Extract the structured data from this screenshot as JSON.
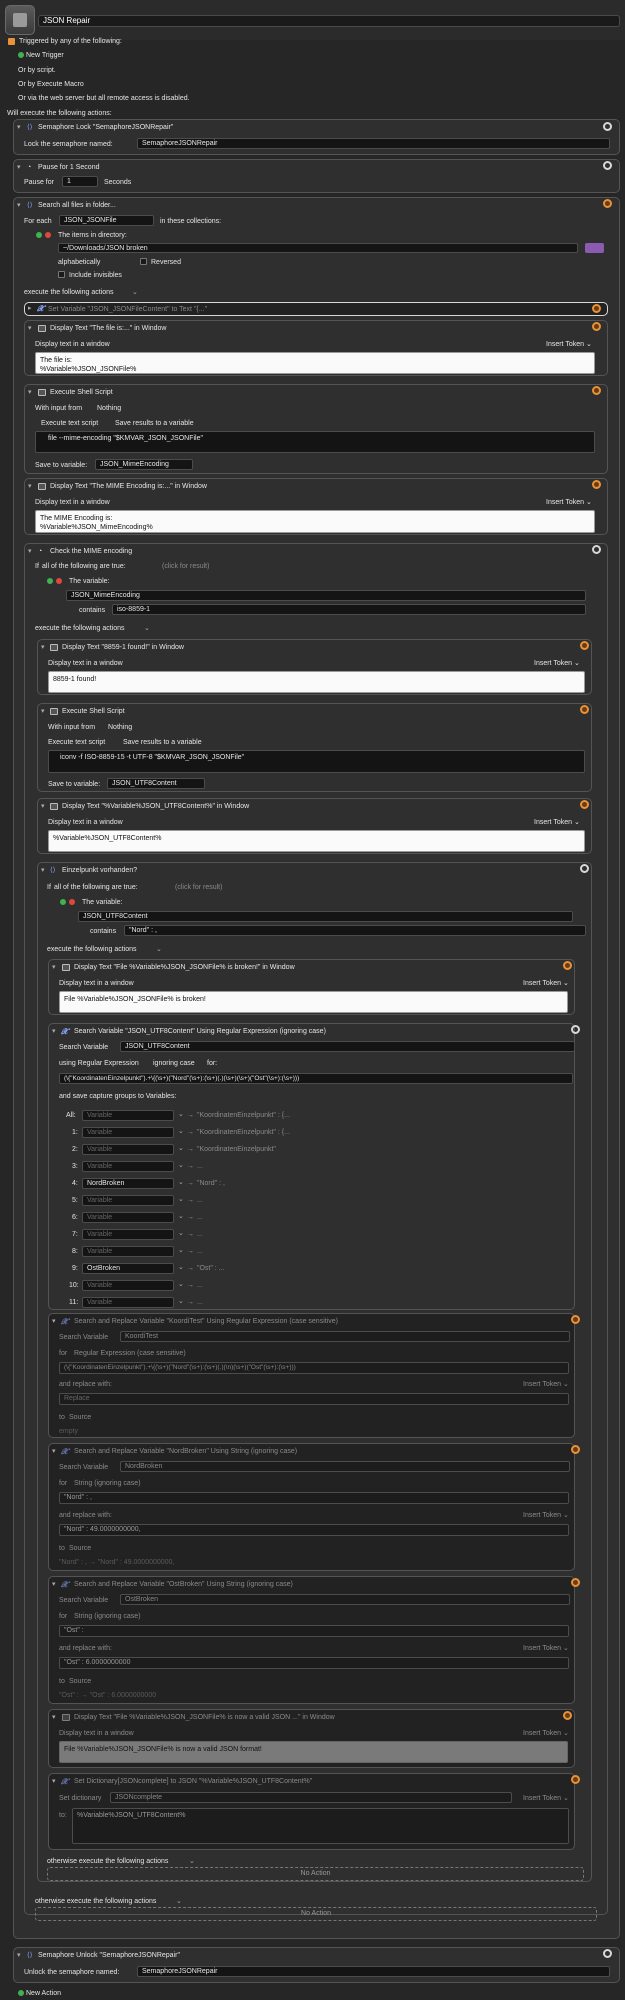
{
  "macro": {
    "name": "JSON Repair",
    "trigger_label": "Triggered by any of the following:",
    "new_trigger": "New Trigger",
    "or_by_script": "Or by script.",
    "or_by_execute_macro": "Or by Execute Macro",
    "web_server": "Or via the web server but all remote access is disabled.",
    "will_execute": "Will execute the following actions:",
    "new_action": "New Action"
  },
  "common": {
    "display_text_in_window": "Display text in a window",
    "insert_token": "Insert Token ⌄",
    "execute_following": "execute the following actions",
    "otherwise": "otherwise execute the following actions",
    "no_action": "No Action",
    "with_input_from": "With input from",
    "nothing": "Nothing",
    "execute_text_script": "Execute text script",
    "save_results": "Save results to a variable",
    "save_to_variable": "Save to variable:",
    "if": "If",
    "all_following_true": "all of the following are true:",
    "click_for_result": "(click for result)",
    "the_variable": "The variable:",
    "contains": "contains",
    "search": "Search",
    "variable": "Variable",
    "for": "for",
    "and_replace_with": "and replace with:",
    "to": "to",
    "source": "Source",
    "empty": "empty"
  },
  "semaphore_lock": {
    "title": "Semaphore Lock \"SemaphoreJSONRepair\"",
    "label": "Lock the semaphore named:",
    "value": "SemaphoreJSONRepair"
  },
  "pause": {
    "title": "Pause for 1 Second",
    "label": "Pause for",
    "value": "1",
    "unit": "Seconds"
  },
  "search_files": {
    "title": "Search all files in folder...",
    "for_each": "For each",
    "var": "JSON_JSONFile",
    "in_collections": "in these collections:",
    "items_in_dir": "The items in directory:",
    "dir": "~/Downloads/JSON broken",
    "sort": "alphabetically",
    "reversed": "Reversed",
    "include_invisibles": "Include invisibles"
  },
  "set_variable": {
    "title": "Set Variable \"JSON_JSONFileContent\" to Text \"{...\""
  },
  "display1": {
    "title": "Display Text \"The file is:...\" in Window",
    "text": "The file is:\n%Variable%JSON_JSONFile%"
  },
  "shell1": {
    "title": "Execute Shell Script",
    "script": "file --mime-encoding \"$KMVAR_JSON_JSONFile\"",
    "save_var": "JSON_MimeEncoding"
  },
  "display2": {
    "title": "Display Text \"The MIME Encoding is:...\" in Window",
    "text": "The MIME Encoding is:\n%Variable%JSON_MimeEncoding%"
  },
  "check_mime": {
    "title": "Check the MIME encoding",
    "variable": "JSON_MimeEncoding",
    "contains_value": "iso-8859-1"
  },
  "display3": {
    "title": "Display Text \"8859-1 found!\" in Window",
    "text": "8859-1 found!"
  },
  "shell2": {
    "title": "Execute Shell Script",
    "script": "iconv -f ISO-8859-15 -t  UTF-8 \"$KMVAR_JSON_JSONFile\"",
    "save_var": "JSON_UTF8Content"
  },
  "display4": {
    "title": "Display Text \"%Variable%JSON_UTF8Content%\" in Window",
    "text": "%Variable%JSON_UTF8Content%"
  },
  "einzel": {
    "title": "Einzelpunkt vorhanden?",
    "variable": "JSON_UTF8Content",
    "contains_value": "\"Nord\" : ,"
  },
  "display5": {
    "title": "Display Text \"File %Variable%JSON_JSONFile% is broken!\" in Window",
    "text": "File %Variable%JSON_JSONFile% is broken!"
  },
  "regex_search": {
    "title": "Search Variable \"JSON_UTF8Content\" Using Regular Expression (ignoring case)",
    "variable": "JSON_UTF8Content",
    "using": "using Regular Expression",
    "ignoring_case": "ignoring case",
    "for_label": "for:",
    "pattern": "(\\{\"KoordinatenEinzelpunkt\").+\\{(\\s+)(\"Nord\"(\\s+):(\\s+)(.)(\\s+)(\\s+)(\"Ost\"(\\s+):(\\s+)))",
    "save_label": "and save capture groups to Variables:",
    "placeholder": "Variable",
    "groups": [
      {
        "label": "All:",
        "var": "",
        "result": "\"KoordinatenEinzelpunkt\" : {..."
      },
      {
        "label": "1:",
        "var": "",
        "result": "\"KoordinatenEinzelpunkt\" : {..."
      },
      {
        "label": "2:",
        "var": "",
        "result": "\"KoordinatenEinzelpunkt\""
      },
      {
        "label": "3:",
        "var": "",
        "result": "..."
      },
      {
        "label": "4:",
        "var": "NordBroken",
        "result": "\"Nord\" : ,"
      },
      {
        "label": "5:",
        "var": "",
        "result": "..."
      },
      {
        "label": "6:",
        "var": "",
        "result": "..."
      },
      {
        "label": "7:",
        "var": "",
        "result": "..."
      },
      {
        "label": "8:",
        "var": "",
        "result": "..."
      },
      {
        "label": "9:",
        "var": "OstBroken",
        "result": "\"Ost\" : ..."
      },
      {
        "label": "10:",
        "var": "",
        "result": "..."
      },
      {
        "label": "11:",
        "var": "",
        "result": "..."
      }
    ]
  },
  "sr1": {
    "title": "Search and Replace Variable \"KoordiTest\" Using Regular Expression (case sensitive)",
    "variable": "KoordiTest",
    "mode": "Regular Expression (case sensitive)",
    "pattern": "(\\{\"KoordinatenEinzelpunkt\").+\\{(\\s+)(\"Nord\"(\\s+):(\\s+)(.)(\\n)(\\s+)(\"Ost\"(\\s+):(\\s+)))",
    "replace": "Replace"
  },
  "sr2": {
    "title": "Search and Replace Variable \"NordBroken\" Using String (ignoring case)",
    "variable": "NordBroken",
    "mode": "String (ignoring case)",
    "search_for": "\"Nord\" : ,",
    "replace": "\"Nord\" : 49.0000000000,",
    "preview": "\"Nord\" : ,  →  \"Nord\" : 49.0000000000,"
  },
  "sr3": {
    "title": "Search and Replace Variable \"OstBroken\" Using String (ignoring case)",
    "variable": "OstBroken",
    "mode": "String (ignoring case)",
    "search_for": "\"Ost\" :",
    "replace": "\"Ost\" : 6.0000000000",
    "preview": "\"Ost\" :  →  \"Ost\" : 6.0000000000"
  },
  "display6": {
    "title": "Display Text \"File %Variable%JSON_JSONFile% is now a valid JSON ...\" in Window",
    "text": "File %Variable%JSON_JSONFile% is now a valid JSON format!"
  },
  "setdict": {
    "title": "Set Dictionary[JSONcomplete] to JSON \"%Variable%JSON_UTF8Content%\"",
    "set_dictionary": "Set dictionary",
    "dict": "JSONcomplete",
    "to_label": "to:",
    "value": "%Variable%JSON_UTF8Content%"
  },
  "semaphore_unlock": {
    "title": "Semaphore Unlock \"SemaphoreJSONRepair\"",
    "label": "Unlock the semaphore named:",
    "value": "SemaphoreJSONRepair"
  }
}
